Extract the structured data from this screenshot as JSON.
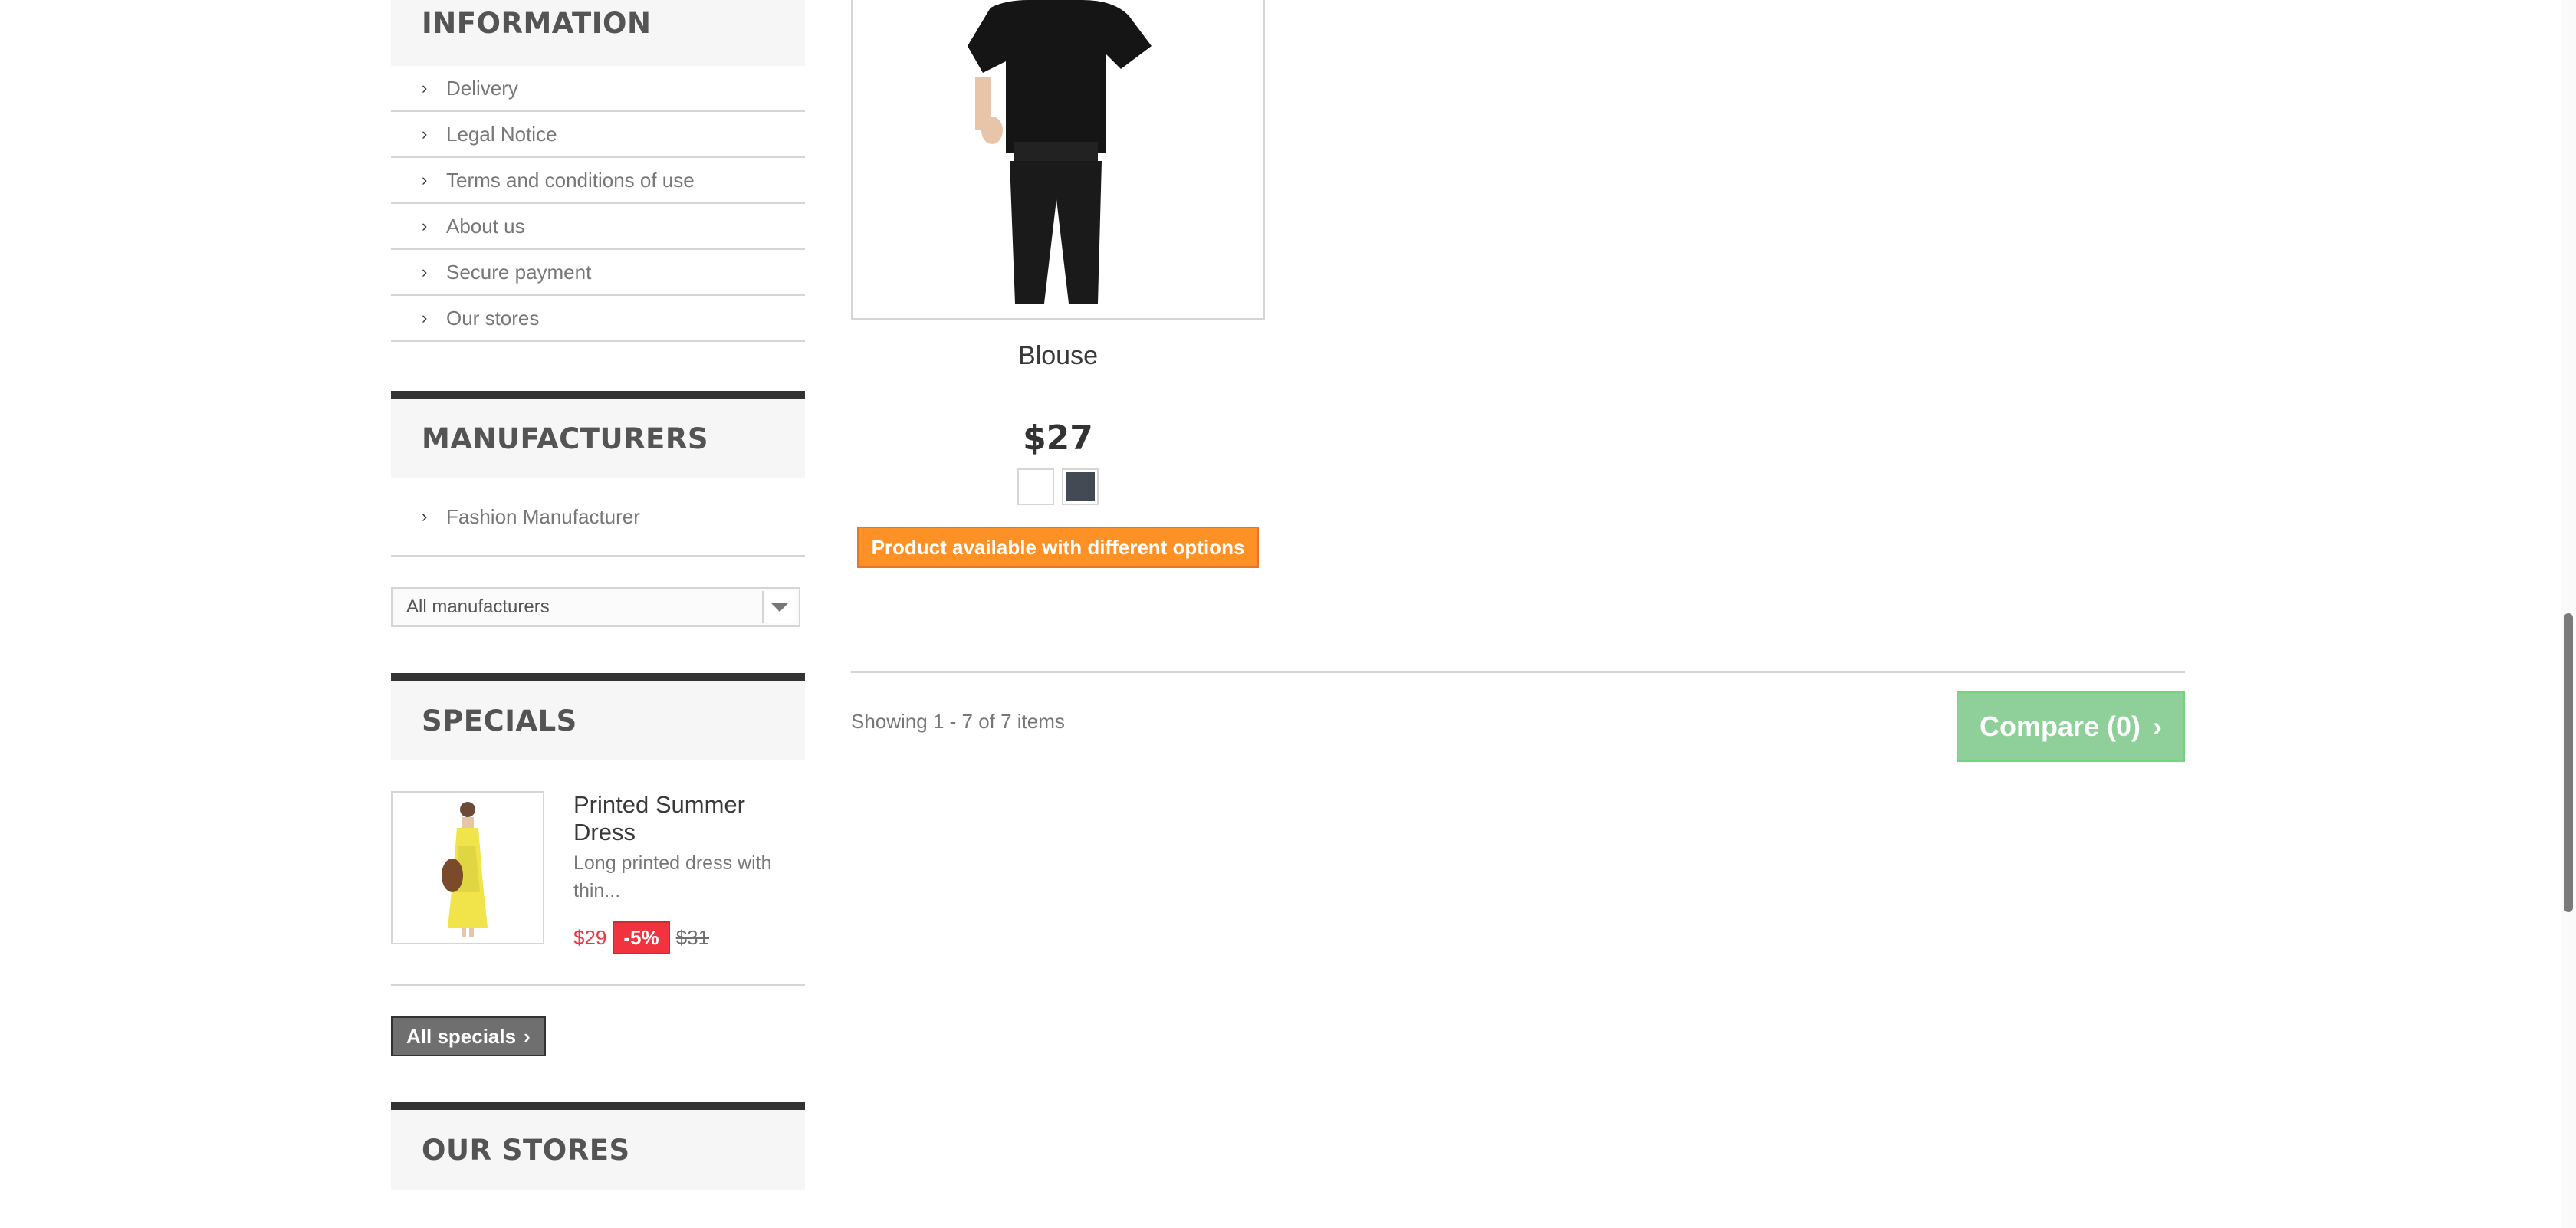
{
  "information": {
    "title": "INFORMATION",
    "items": [
      "Delivery",
      "Legal Notice",
      "Terms and conditions of use",
      "About us",
      "Secure payment",
      "Our stores"
    ]
  },
  "manufacturers": {
    "title": "MANUFACTURERS",
    "item": "Fashion Manufacturer",
    "select_value": "All manufacturers"
  },
  "specials": {
    "title": "SPECIALS",
    "product_name": "Printed Summer Dress",
    "product_desc": "Long printed dress with thin...",
    "price_new": "$29",
    "discount": "-5%",
    "price_old": "$31",
    "all_specials_label": "All specials"
  },
  "stores": {
    "title": "OUR STORES"
  },
  "product": {
    "name": "Blouse",
    "price": "$27",
    "colors": [
      "#ffffff",
      "#434a54"
    ],
    "options_label": "Product available with different options"
  },
  "pagination": {
    "showing": "Showing 1 - 7 of 7 items"
  },
  "compare": {
    "label": "Compare (0)"
  },
  "colors": {
    "compare_bg": "#8fd09a",
    "options_badge": "#fe9126",
    "discount_red": "#f13340"
  }
}
